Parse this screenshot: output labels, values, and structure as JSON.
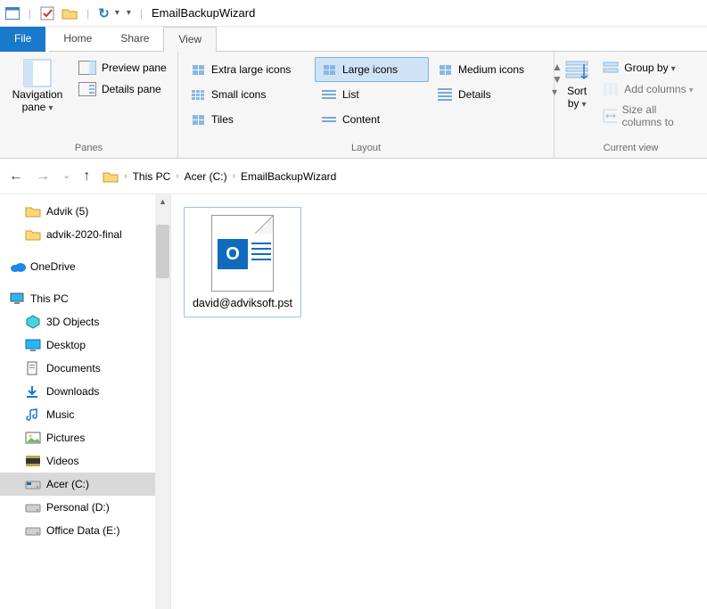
{
  "titlebar": {
    "app_separator": "|",
    "window_title": "EmailBackupWizard"
  },
  "tabs": {
    "file": "File",
    "home": "Home",
    "share": "Share",
    "view": "View",
    "active": "view"
  },
  "ribbon": {
    "panes": {
      "label": "Panes",
      "navigation": "Navigation pane",
      "preview": "Preview pane",
      "details": "Details pane"
    },
    "layout": {
      "label": "Layout",
      "options": {
        "xl": "Extra large icons",
        "lg": "Large icons",
        "md": "Medium icons",
        "sm": "Small icons",
        "list": "List",
        "details": "Details",
        "tiles": "Tiles",
        "content": "Content"
      },
      "selected": "lg"
    },
    "currentview": {
      "label": "Current view",
      "sort": "Sort by",
      "group": "Group by",
      "addcols": "Add columns",
      "sizecols": "Size all columns to"
    }
  },
  "breadcrumbs": [
    "This PC",
    "Acer (C:)",
    "EmailBackupWizard"
  ],
  "tree": {
    "items": [
      {
        "name": "Advik (5)",
        "indent": 1,
        "icon": "folder"
      },
      {
        "name": "advik-2020-final",
        "indent": 1,
        "icon": "folder"
      },
      {
        "name": "",
        "indent": 0,
        "icon": "spacer"
      },
      {
        "name": "OneDrive",
        "indent": 0,
        "icon": "onedrive"
      },
      {
        "name": "",
        "indent": 0,
        "icon": "spacer"
      },
      {
        "name": "This PC",
        "indent": 0,
        "icon": "pc"
      },
      {
        "name": "3D Objects",
        "indent": 1,
        "icon": "3d"
      },
      {
        "name": "Desktop",
        "indent": 1,
        "icon": "desktop"
      },
      {
        "name": "Documents",
        "indent": 1,
        "icon": "docs"
      },
      {
        "name": "Downloads",
        "indent": 1,
        "icon": "down"
      },
      {
        "name": "Music",
        "indent": 1,
        "icon": "music"
      },
      {
        "name": "Pictures",
        "indent": 1,
        "icon": "pics"
      },
      {
        "name": "Videos",
        "indent": 1,
        "icon": "vids"
      },
      {
        "name": "Acer (C:)",
        "indent": 1,
        "icon": "drive",
        "selected": true
      },
      {
        "name": "Personal (D:)",
        "indent": 1,
        "icon": "drive2"
      },
      {
        "name": "Office Data (E:)",
        "indent": 1,
        "icon": "drive2"
      }
    ]
  },
  "files": [
    {
      "name": "david@adviksoft.pst",
      "type": "pst"
    }
  ]
}
